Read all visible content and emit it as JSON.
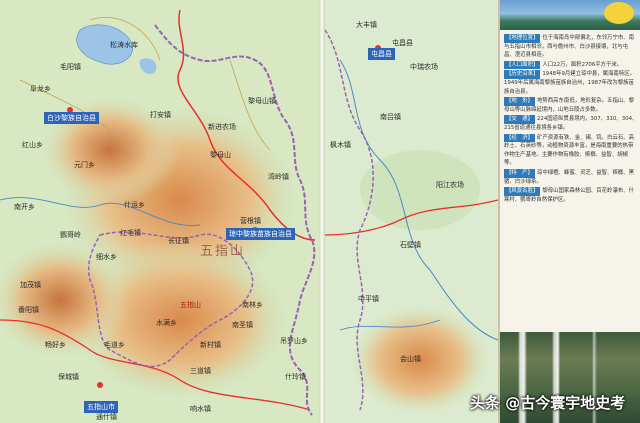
{
  "map": {
    "region_title": "五指山",
    "towns": [
      "毛阳镇",
      "番阳镇",
      "南开乡",
      "元门乡",
      "什运乡",
      "营根镇",
      "红毛镇",
      "新进农场",
      "黎母山镇",
      "湾岭镇",
      "长征镇",
      "吊罗山乡",
      "什玲镇",
      "保城镇",
      "水满乡",
      "通什镇",
      "畅好乡",
      "毛道乡",
      "南圣镇",
      "三道镇",
      "南林乡",
      "响水镇",
      "加茂镇",
      "新村镇",
      "红山乡",
      "阜龙乡",
      "打安镇",
      "细水乡",
      "大丰镇",
      "中瑞农场",
      "屯昌县",
      "中平镇",
      "枫木镇",
      "南吕镇",
      "阳江农场",
      "会山镇",
      "石壁镇",
      "黎母山",
      "鹦哥岭",
      "五指山"
    ],
    "seats": [
      "白沙黎族自治县",
      "琼中黎族苗族自治县",
      "五指山市",
      "屯昌县"
    ],
    "lake": "松涛水库"
  },
  "sidebar": {
    "sections": [
      {
        "head": "【地理位置】",
        "text": "位于海南岛中部偏北，东邻万宁市、南与五指山市相邻，西与儋州市、白沙县接壤，北与屯昌、澄迈县相连。"
      },
      {
        "head": "【人口面积】",
        "text": "人口22万，面积2706平方千米。"
      },
      {
        "head": "【历史沿革】",
        "text": "1948年9月建立琼中县，属海南特区。1949年后属海南黎族苗族自治州，1987年改为黎族苗族自治县。"
      },
      {
        "head": "【地　形】",
        "text": "地势西高东南低，地形复杂。五指山、黎母山等山脉绵延境内，山地丘陵占多数。"
      },
      {
        "head": "【交　通】",
        "text": "224国道纵贯县境内，307、310、304、215省道通往县境各乡镇。"
      },
      {
        "head": "【经　济】",
        "text": "矿产资源有铁、金、锡、钨、白云石、高岭土、石英砂等，动植物资源丰富，是海南重要的热带作物生产基地。主要作物有橡胶、槟榔、益智、胡椒等。"
      },
      {
        "head": "【特　产】",
        "text": "琼中绿橙、蜂蜜、灵芝、益智、槟榔、黑猪、白沙绿茶。"
      },
      {
        "head": "【风景名胜】",
        "text": "黎母山国家森林公园、百花岭瀑布、什寒村、鹦哥岭自然保护区。"
      }
    ]
  },
  "watermark": "头条 @古今寰宇地史考"
}
